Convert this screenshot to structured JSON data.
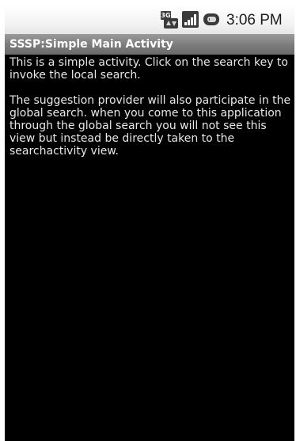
{
  "status_bar": {
    "network_label": "3G",
    "time": "3:06 PM",
    "icons": {
      "network": "3g-data-icon",
      "signal": "signal-strength-icon",
      "battery": "battery-charging-icon"
    }
  },
  "title_bar": {
    "title": "SSSP:Simple Main Activity"
  },
  "content": {
    "paragraph_1": "This is a simple activity. Click on the search key to invoke the local search.",
    "paragraph_2": " The suggestion provider will also participate in the global search. when you come to this application through the global search you will not see this view but instead be directly taken to the searchactivity view."
  },
  "colors": {
    "background": "#000000",
    "status_bar": "#f2f2f2",
    "title_bar": "#7f7f7f",
    "text": "#e8e8e8"
  }
}
